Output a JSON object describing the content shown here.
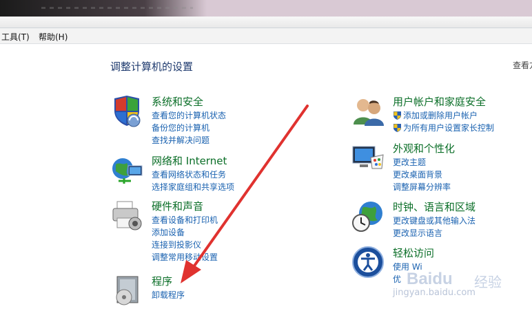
{
  "menu": {
    "tools": "工具(T)",
    "help": "帮助(H)"
  },
  "page_title": "调整计算机的设置",
  "view_by_label": "查看方",
  "categories": [
    {
      "id": "system",
      "title": "系统和安全",
      "links": [
        "查看您的计算机状态",
        "备份您的计算机",
        "查找并解决问题"
      ]
    },
    {
      "id": "network",
      "title": "网络和 Internet",
      "links": [
        "查看网络状态和任务",
        "选择家庭组和共享选项"
      ]
    },
    {
      "id": "hardware",
      "title": "硬件和声音",
      "links": [
        "查看设备和打印机",
        "添加设备",
        "连接到投影仪",
        "调整常用移动设置"
      ]
    },
    {
      "id": "programs",
      "title": "程序",
      "links": [
        "卸载程序"
      ]
    },
    {
      "id": "accounts",
      "title": "用户帐户和家庭安全",
      "links": [
        "添加或删除用户帐户",
        "为所有用户设置家长控制"
      ]
    },
    {
      "id": "appearance",
      "title": "外观和个性化",
      "links": [
        "更改主题",
        "更改桌面背景",
        "调整屏幕分辨率"
      ]
    },
    {
      "id": "clock",
      "title": "时钟、语言和区域",
      "links": [
        "更改键盘或其他输入法",
        "更改显示语言"
      ]
    },
    {
      "id": "ease",
      "title": "轻松访问",
      "links": [
        "使用 Wi",
        "优"
      ]
    }
  ],
  "watermark": {
    "brand": "Baidu",
    "suffix": "经验",
    "url": "jingyan.baidu.com"
  },
  "colors": {
    "title_green": "#0a6e27",
    "link_blue": "#1a62b0",
    "heading_blue": "#1e3a6e",
    "arrow_red": "#e0322f"
  },
  "icons": {
    "system": "security-shield-icon",
    "network": "globe-network-icon",
    "hardware": "printer-icon",
    "programs": "program-box-icon",
    "accounts": "users-icon",
    "appearance": "display-palette-icon",
    "clock": "globe-clock-icon",
    "ease": "accessibility-icon"
  }
}
